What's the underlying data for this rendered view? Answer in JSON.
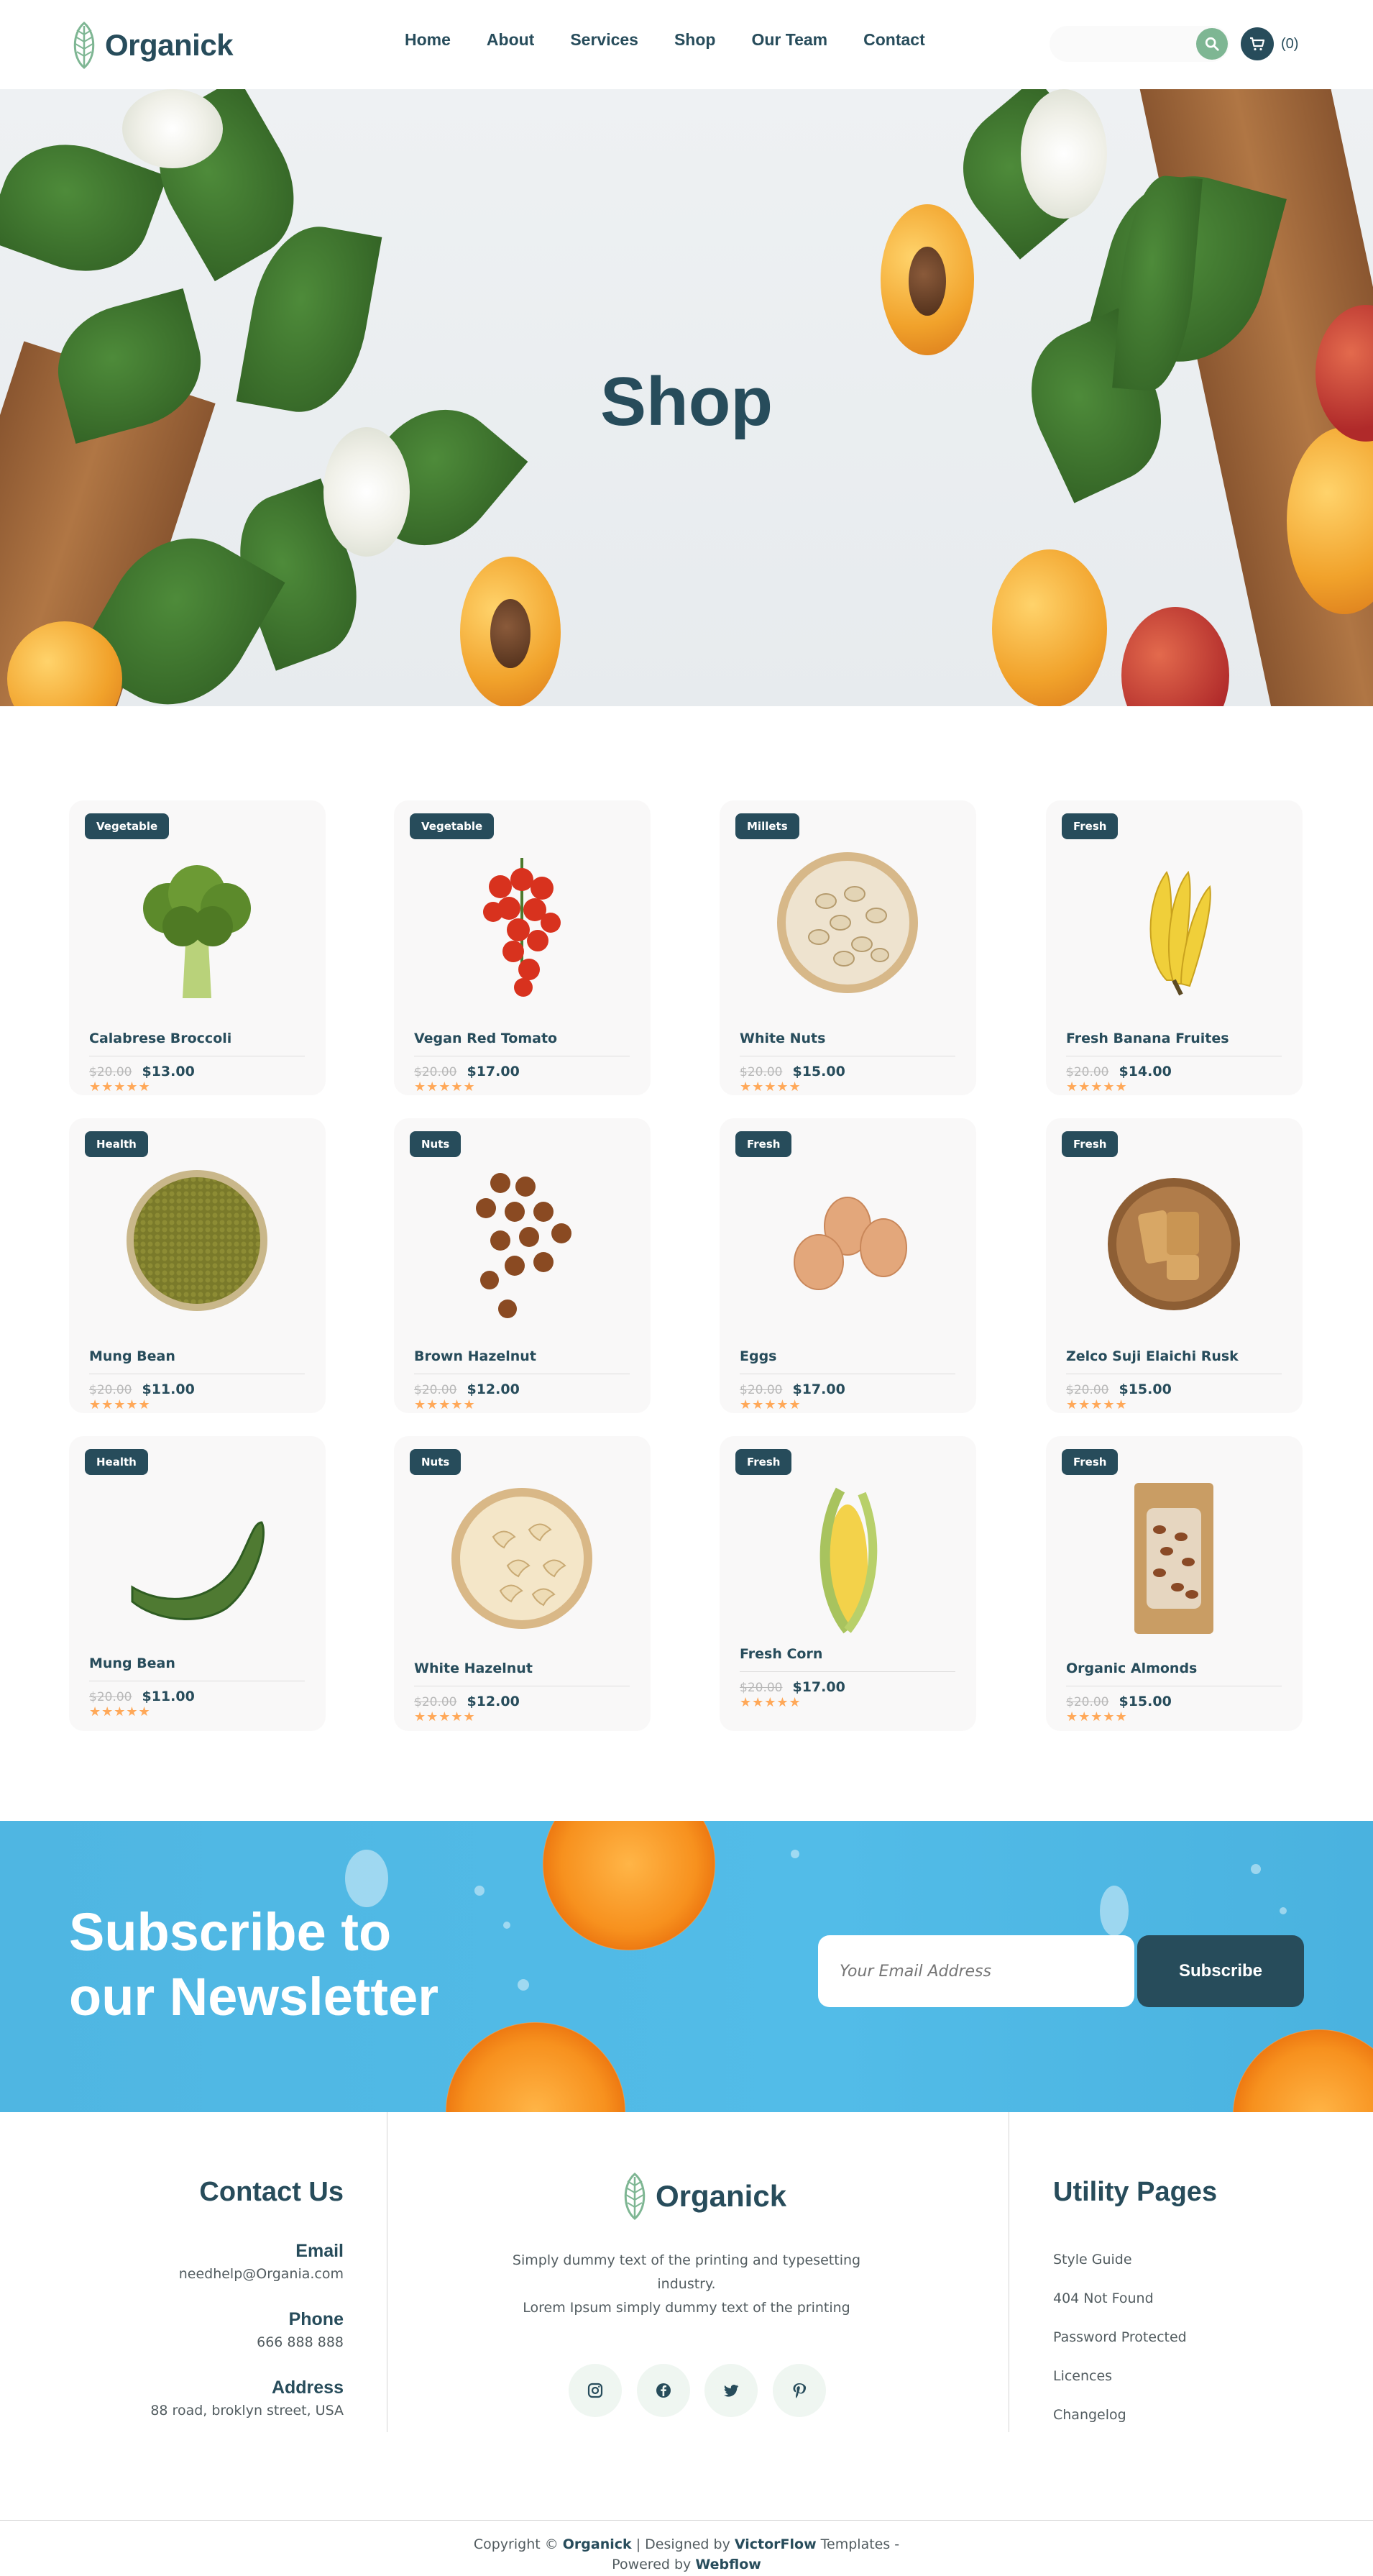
{
  "brand": {
    "name": "Organick"
  },
  "nav": {
    "items": [
      "Home",
      "About",
      "Services",
      "Shop",
      "Our Team",
      "Contact"
    ]
  },
  "search": {
    "placeholder": ""
  },
  "cart": {
    "count_label": "(0)"
  },
  "hero": {
    "title": "Shop"
  },
  "products": [
    {
      "tag": "Vegetable",
      "name": "Calabrese Broccoli",
      "old_price": "$20.00",
      "price": "$13.00",
      "rating": 5,
      "icon": "broccoli-icon"
    },
    {
      "tag": "Vegetable",
      "name": "Vegan Red Tomato",
      "old_price": "$20.00",
      "price": "$17.00",
      "rating": 5,
      "icon": "tomato-icon"
    },
    {
      "tag": "Millets",
      "name": "White Nuts",
      "old_price": "$20.00",
      "price": "$15.00",
      "rating": 5,
      "icon": "nuts-bowl-icon"
    },
    {
      "tag": "Fresh",
      "name": "Fresh Banana Fruites",
      "old_price": "$20.00",
      "price": "$14.00",
      "rating": 5,
      "icon": "banana-icon"
    },
    {
      "tag": "Health",
      "name": "Mung Bean",
      "old_price": "$20.00",
      "price": "$11.00",
      "rating": 5,
      "icon": "mung-bean-bowl-icon"
    },
    {
      "tag": "Nuts",
      "name": "Brown Hazelnut",
      "old_price": "$20.00",
      "price": "$12.00",
      "rating": 5,
      "icon": "hazelnut-icon"
    },
    {
      "tag": "Fresh",
      "name": "Eggs",
      "old_price": "$20.00",
      "price": "$17.00",
      "rating": 5,
      "icon": "eggs-icon"
    },
    {
      "tag": "Fresh",
      "name": "Zelco Suji Elaichi Rusk",
      "old_price": "$20.00",
      "price": "$15.00",
      "rating": 5,
      "icon": "rusk-icon"
    },
    {
      "tag": "Health",
      "name": "Mung Bean",
      "old_price": "$20.00",
      "price": "$11.00",
      "rating": 5,
      "icon": "gourd-icon"
    },
    {
      "tag": "Nuts",
      "name": "White Hazelnut",
      "old_price": "$20.00",
      "price": "$12.00",
      "rating": 5,
      "icon": "cashew-bowl-icon"
    },
    {
      "tag": "Fresh",
      "name": "Fresh Corn",
      "old_price": "$20.00",
      "price": "$17.00",
      "rating": 5,
      "icon": "corn-icon"
    },
    {
      "tag": "Fresh",
      "name": "Organic Almonds",
      "old_price": "$20.00",
      "price": "$15.00",
      "rating": 5,
      "icon": "almond-bag-icon"
    }
  ],
  "newsletter": {
    "title_line1": "Subscribe to",
    "title_line2": "our Newsletter",
    "email_placeholder": "Your Email Address",
    "button": "Subscribe"
  },
  "footer": {
    "contact": {
      "title": "Contact Us",
      "email_label": "Email",
      "email": "needhelp@Organia.com",
      "phone_label": "Phone",
      "phone": "666 888 888",
      "address_label": "Address",
      "address": "88 road, broklyn street, USA"
    },
    "about": {
      "line1": "Simply dummy text of the printing and typesetting",
      "line2": "industry.",
      "line3": "Lorem Ipsum simply dummy text of the printing"
    },
    "social": [
      "instagram-icon",
      "facebook-icon",
      "twitter-icon",
      "pinterest-icon"
    ],
    "utility": {
      "title": "Utility Pages",
      "links": [
        "Style Guide",
        "404 Not Found",
        "Password Protected",
        "Licences",
        "Changelog"
      ]
    },
    "copyright": {
      "prefix": "Copyright © ",
      "brand": "Organick",
      "designed": " | Designed by ",
      "designer": "VictorFlow",
      "templates": " Templates - ",
      "powered": "Powered by ",
      "platform": "Webflow"
    }
  },
  "colors": {
    "primary": "#274C5B",
    "accent": "#7EB693",
    "star": "#FFA858",
    "newsletter_bg": "#4FB6E2"
  }
}
